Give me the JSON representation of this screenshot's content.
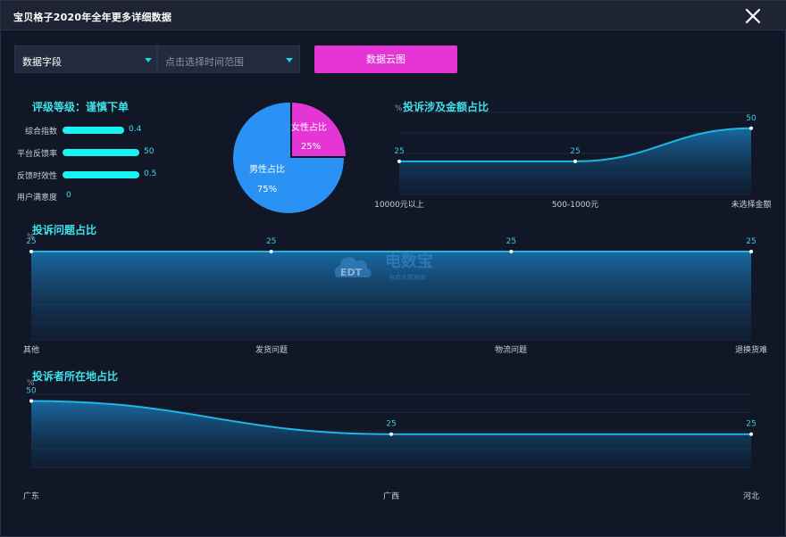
{
  "modal": {
    "title": "宝贝格子2020年全年更多详细数据"
  },
  "filters": {
    "field_select": "数据字段",
    "time_range_placeholder": "点击选择时间范围",
    "cloud_button": "数据云图"
  },
  "rating": {
    "title": "评级等级：谨慎下单",
    "items": [
      {
        "label": "综合指数",
        "value": "0.4",
        "fill": 0.52
      },
      {
        "label": "平台反馈率",
        "value": "50",
        "fill": 0.65
      },
      {
        "label": "反馈时效性",
        "value": "0.5",
        "fill": 0.65
      },
      {
        "label": "用户满意度",
        "value": "0",
        "fill": 0
      }
    ]
  },
  "gender": {
    "female_label": "女性占比",
    "female_value": "25%",
    "male_label": "男性占比",
    "male_value": "75%"
  },
  "watermark": {
    "text": "电数宝",
    "sub": "电商大数据库",
    "logo": "EDT"
  },
  "colors": {
    "accent": "#18f2f2",
    "line": "#1fb6e0",
    "magenta": "#e535d6",
    "pie_blue": "#2b92f5"
  },
  "chart_data": [
    {
      "type": "pie",
      "categories": [
        "女性占比",
        "男性占比"
      ],
      "values": [
        25,
        75
      ]
    },
    {
      "type": "area",
      "title": "投诉涉及金额占比",
      "ylabel": "%",
      "categories": [
        "10000元以上",
        "500-1000元",
        "未选择金额"
      ],
      "values": [
        25,
        25,
        50
      ],
      "ylim": [
        0,
        62
      ]
    },
    {
      "type": "area",
      "title": "投诉问题占比",
      "ylabel": "%",
      "categories": [
        "其他",
        "发货问题",
        "物流问题",
        "退换货难"
      ],
      "values": [
        25,
        25,
        25,
        25
      ],
      "ylim": [
        0,
        25
      ]
    },
    {
      "type": "area",
      "title": "投诉者所在地占比",
      "ylabel": "%",
      "categories": [
        "广东",
        "广西",
        "河北"
      ],
      "values": [
        50,
        25,
        25
      ],
      "ylim": [
        0,
        55
      ]
    }
  ]
}
